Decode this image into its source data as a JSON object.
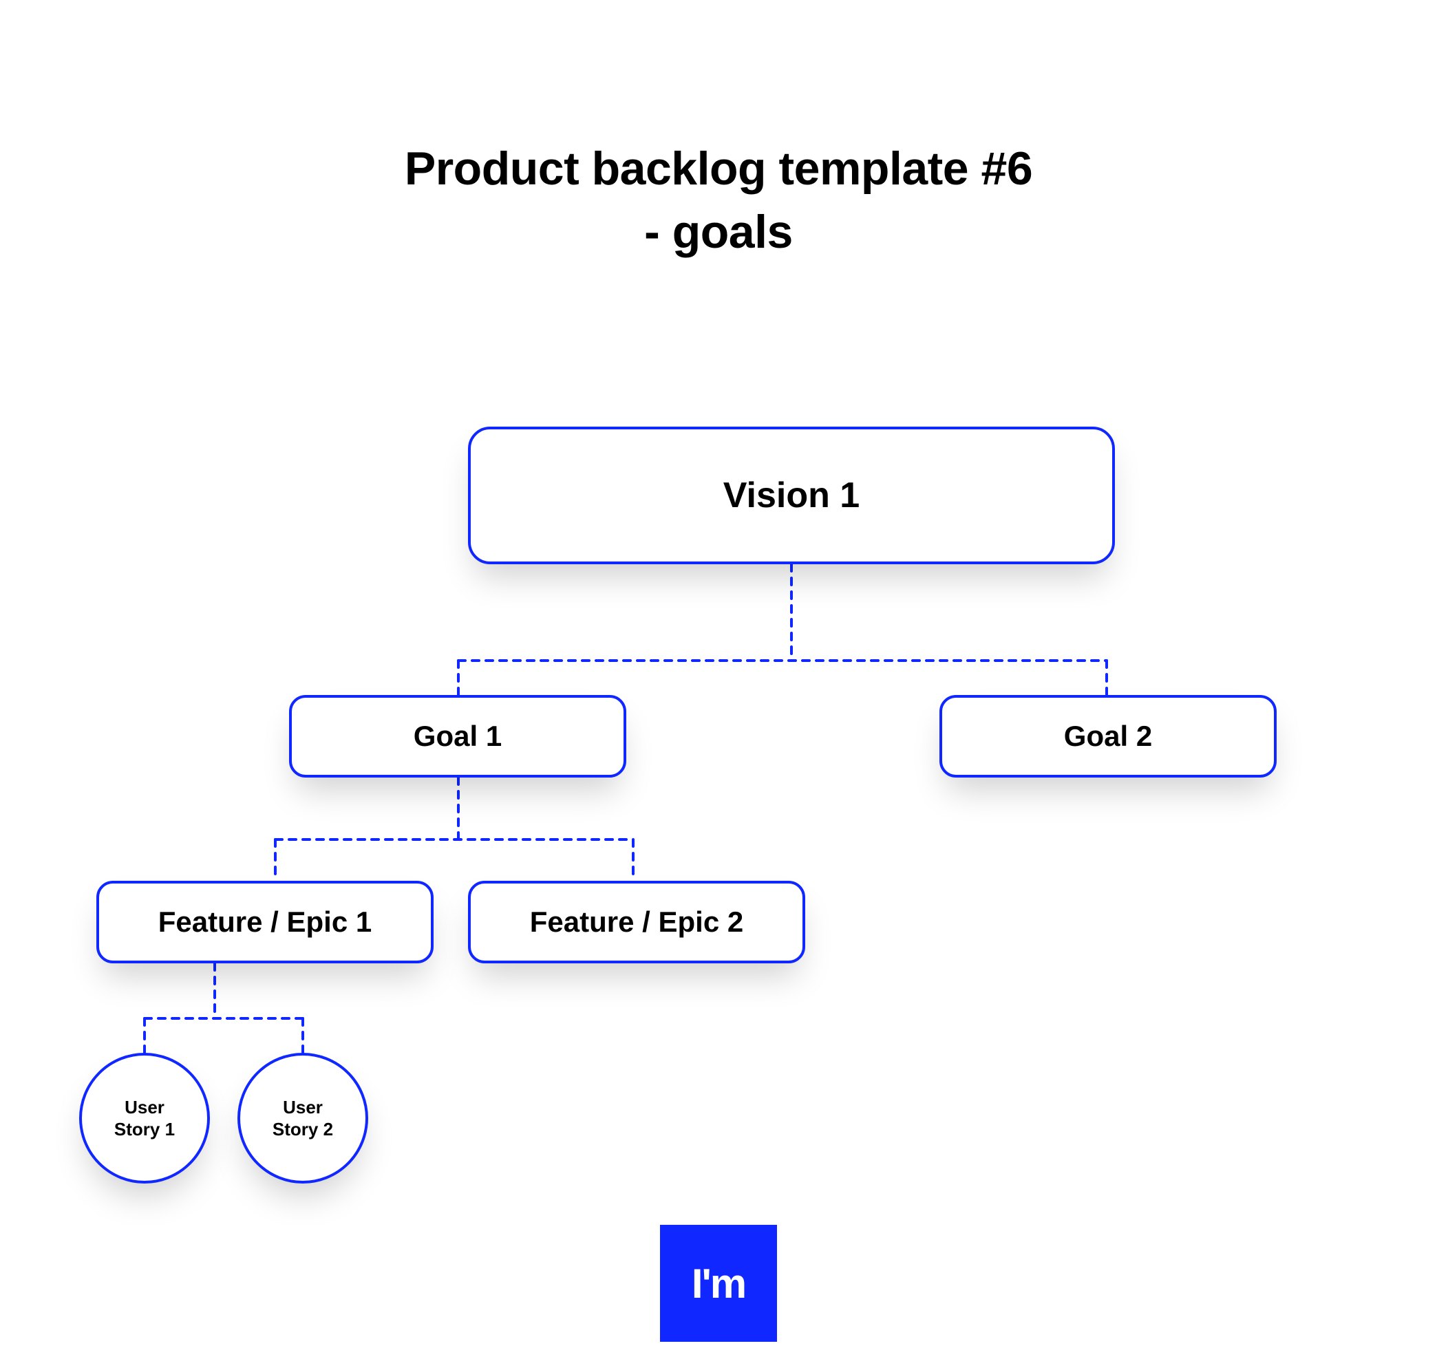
{
  "title": {
    "line1": "Product backlog template #6",
    "line2": "- goals"
  },
  "nodes": {
    "vision": {
      "label": "Vision 1"
    },
    "goal1": {
      "label": "Goal 1"
    },
    "goal2": {
      "label": "Goal 2"
    },
    "epic1": {
      "label": "Feature / Epic 1"
    },
    "epic2": {
      "label": "Feature / Epic 2"
    },
    "story1_line1": "User",
    "story1_line2": "Story 1",
    "story2_line1": "User",
    "story2_line2": "Story 2"
  },
  "logo": {
    "text": "I'm"
  },
  "colors": {
    "stroke": "#1028ff",
    "bg": "#ffffff"
  }
}
